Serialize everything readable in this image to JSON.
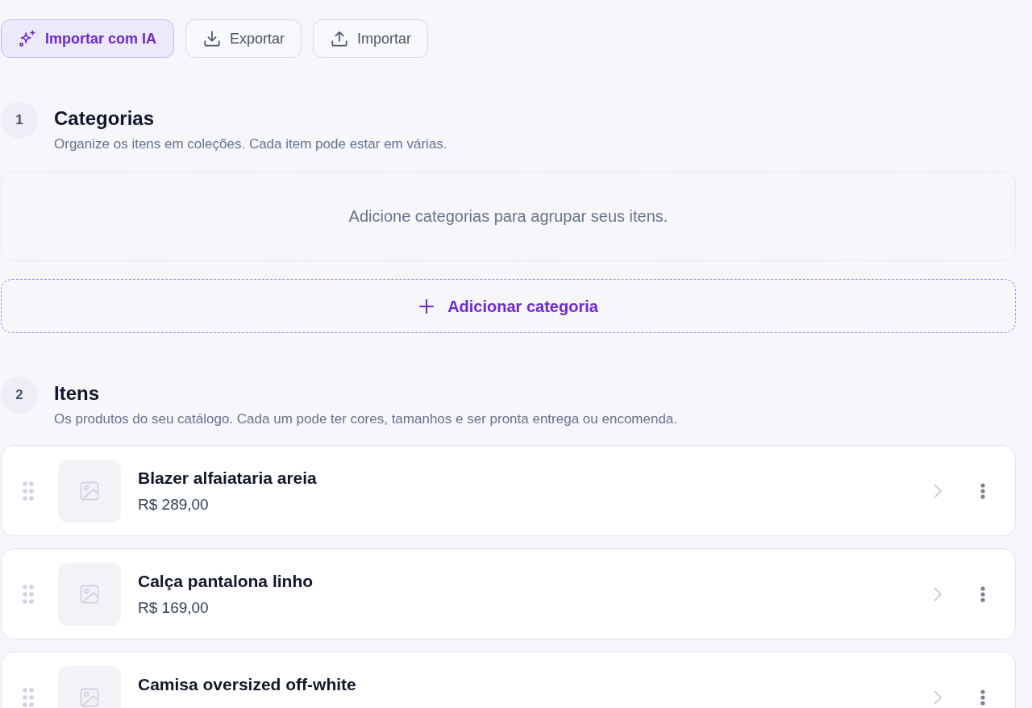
{
  "toolbar": {
    "buttons": [
      {
        "kind": "ai",
        "label": "Importar com IA"
      },
      {
        "kind": "export",
        "label": "Exportar"
      },
      {
        "kind": "import",
        "label": "Importar"
      }
    ]
  },
  "sections": [
    {
      "kind": "categories",
      "number": "1",
      "title": "Categorias",
      "subtitle": "Organize os itens em coleções. Cada item pode estar em várias.",
      "empty_message": "Adicione categorias para agrupar seus itens.",
      "add_button": "Adicionar categoria"
    },
    {
      "kind": "items",
      "number": "2",
      "title": "Itens",
      "subtitle": "Os produtos do seu catálogo. Cada um pode ter cores, tamanhos e ser pronta entrega ou encomenda.",
      "items": [
        {
          "name": "Blazer alfaiataria areia",
          "price": "R$ 289,00"
        },
        {
          "name": "Calça pantalona linho",
          "price": "R$ 169,00"
        },
        {
          "name": "Camisa oversized off-white"
        }
      ]
    }
  ]
}
